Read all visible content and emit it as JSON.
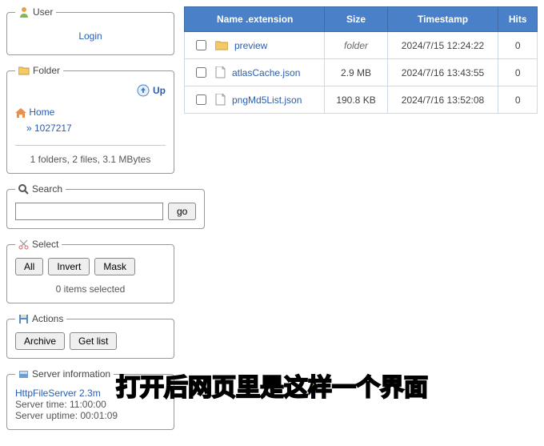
{
  "user": {
    "legend": "User",
    "login": "Login"
  },
  "folder": {
    "legend": "Folder",
    "up": "Up",
    "home": "Home",
    "path": "» 1027217",
    "stats": "1 folders, 2 files, 3.1 MBytes"
  },
  "search": {
    "legend": "Search",
    "go": "go"
  },
  "select": {
    "legend": "Select",
    "all": "All",
    "invert": "Invert",
    "mask": "Mask",
    "info": "0 items selected"
  },
  "actions": {
    "legend": "Actions",
    "archive": "Archive",
    "getlist": "Get list"
  },
  "server": {
    "legend": "Server information",
    "link": "HttpFileServer 2.3m",
    "time": "Server time: 11:00:00",
    "uptime": "Server uptime: 00:01:09"
  },
  "table": {
    "headers": {
      "name": "Name .extension",
      "size": "Size",
      "timestamp": "Timestamp",
      "hits": "Hits"
    },
    "rows": [
      {
        "name": "preview",
        "size": "folder",
        "ts": "2024/7/15 12:24:22",
        "hits": "0",
        "type": "folder"
      },
      {
        "name": "atlasCache.json",
        "size": "2.9 MB",
        "ts": "2024/7/16 13:43:55",
        "hits": "0",
        "type": "file"
      },
      {
        "name": "pngMd5List.json",
        "size": "190.8 KB",
        "ts": "2024/7/16 13:52:08",
        "hits": "0",
        "type": "file"
      }
    ]
  },
  "caption": "打开后网页里是这样一个界面"
}
